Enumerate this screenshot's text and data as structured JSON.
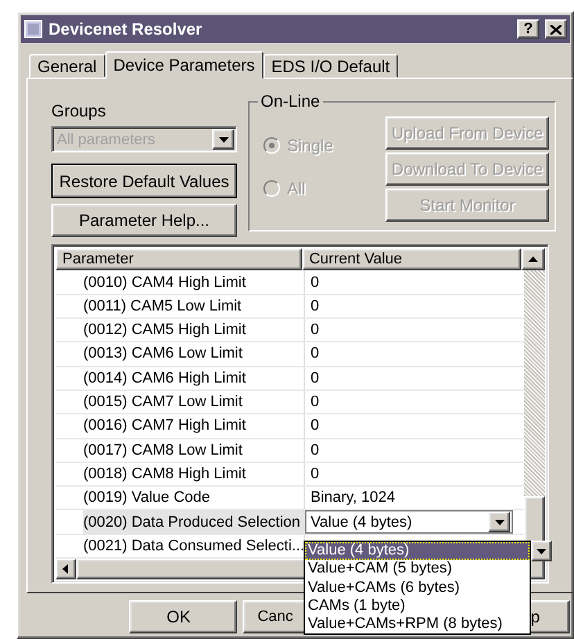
{
  "window": {
    "title": "Devicenet Resolver",
    "help_button": "?"
  },
  "tabs": [
    {
      "label": "General",
      "selected": false
    },
    {
      "label": "Device Parameters",
      "selected": true
    },
    {
      "label": "EDS I/O Default",
      "selected": false
    }
  ],
  "groups": {
    "label": "Groups",
    "value": "All parameters",
    "disabled": true
  },
  "left_buttons": [
    "Restore Default Values",
    "Parameter Help..."
  ],
  "online": {
    "title": "On-Line",
    "disabled": true,
    "radios": [
      {
        "label": "Single",
        "selected": true
      },
      {
        "label": "All",
        "selected": false
      }
    ],
    "buttons": [
      "Upload From Device",
      "Download To Device",
      "Start Monitor"
    ]
  },
  "table": {
    "columns": [
      "Parameter",
      "Current Value"
    ],
    "rows": [
      {
        "parameter": "(0010) CAM4 High Limit",
        "value": "0",
        "kind": "text",
        "selected": false
      },
      {
        "parameter": "(0011) CAM5 Low Limit",
        "value": "0",
        "kind": "text",
        "selected": false
      },
      {
        "parameter": "(0012) CAM5 High Limit",
        "value": "0",
        "kind": "text",
        "selected": false
      },
      {
        "parameter": "(0013) CAM6 Low Limit",
        "value": "0",
        "kind": "text",
        "selected": false
      },
      {
        "parameter": "(0014) CAM6 High Limit",
        "value": "0",
        "kind": "text",
        "selected": false
      },
      {
        "parameter": "(0015) CAM7 Low Limit",
        "value": "0",
        "kind": "text",
        "selected": false
      },
      {
        "parameter": "(0016) CAM7 High Limit",
        "value": "0",
        "kind": "text",
        "selected": false
      },
      {
        "parameter": "(0017) CAM8 Low Limit",
        "value": "0",
        "kind": "text",
        "selected": false
      },
      {
        "parameter": "(0018) CAM8 High Limit",
        "value": "0",
        "kind": "text",
        "selected": false
      },
      {
        "parameter": "(0019) Value Code",
        "value": "Binary, 1024",
        "kind": "text",
        "selected": false
      },
      {
        "parameter": "(0020) Data Produced Selection",
        "value": "Value (4 bytes)",
        "kind": "combo",
        "selected": true,
        "options": [
          {
            "label": "Value (4 bytes)",
            "selected": true
          },
          {
            "label": "Value+CAM (5 bytes)",
            "selected": false
          },
          {
            "label": "Value+CAMs (6 bytes)",
            "selected": false
          },
          {
            "label": "CAMs (1 byte)",
            "selected": false
          },
          {
            "label": "Value+CAMs+RPM (8 bytes)",
            "selected": false
          }
        ]
      },
      {
        "parameter": "(0021) Data Consumed Selecti...",
        "kind": "covered-combo",
        "selected": false
      }
    ]
  },
  "bottom_buttons": [
    "OK",
    "Canc",
    "p"
  ]
}
